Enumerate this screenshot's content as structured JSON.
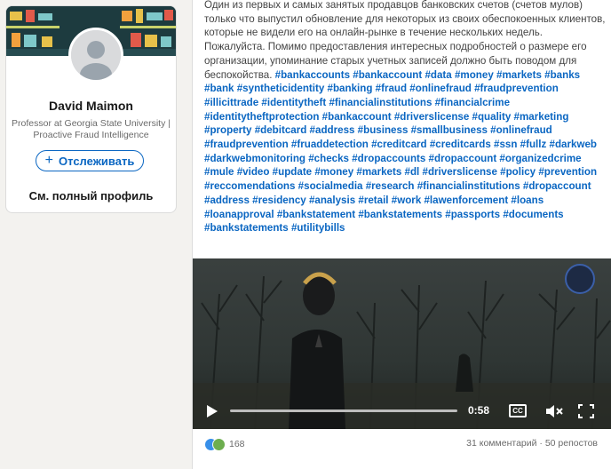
{
  "profile": {
    "name": "David Maimon",
    "headline": "Professor at Georgia State University | Proactive Fraud Intelligence",
    "follow_label": "Отслеживать",
    "follow_icon": "plus-icon",
    "full_profile_label": "См. полный профиль"
  },
  "post": {
    "body": "Один из первых и самых занятых продавцов банковских счетов (счетов мулов) только что выпустил обновление для некоторых из своих обеспокоенных клиентов, которые не видели его на онлайн-рынке в течение нескольких недель. Пожалуйста. Помимо предоставления интересных подробностей о размере его организации, упоминание старых учетных записей должно быть поводом для беспокойства. ",
    "hashtags": "#bankaccounts #bankaccount #data #money #markets #banks #bank #syntheticidentity #banking #fraud #onlinefraud #fraudprevention #illicittrade #identitytheft #financialinstitutions #financialcrime #identitytheftprotection #bankaccount #driverslicense #quality #marketing #property #debitcard #address #business #smallbusiness #onlinefraud #fraudprevention #fruaddetection #creditcard #creditcards #ssn #fullz #darkweb #darkwebmonitoring #checks #dropaccounts #dropaccount #organizedcrime #mule #video #update  #money #markets #dl #driverslicense #policy #prevention #reccomendations #socialmedia #research #financialinstitutions #dropaccount #address #residency #analysis #retail #work #lawenforcement #loans #loanapproval #bankstatement #bankstatements #passports #documents #bankstatements #utilitybills"
  },
  "video": {
    "time": "0:58",
    "cc_label": "CC",
    "progress": 0.0
  },
  "social": {
    "reaction_count": "168",
    "comments": "31 комментарий",
    "separator": " · ",
    "reposts": "50 репостов"
  }
}
